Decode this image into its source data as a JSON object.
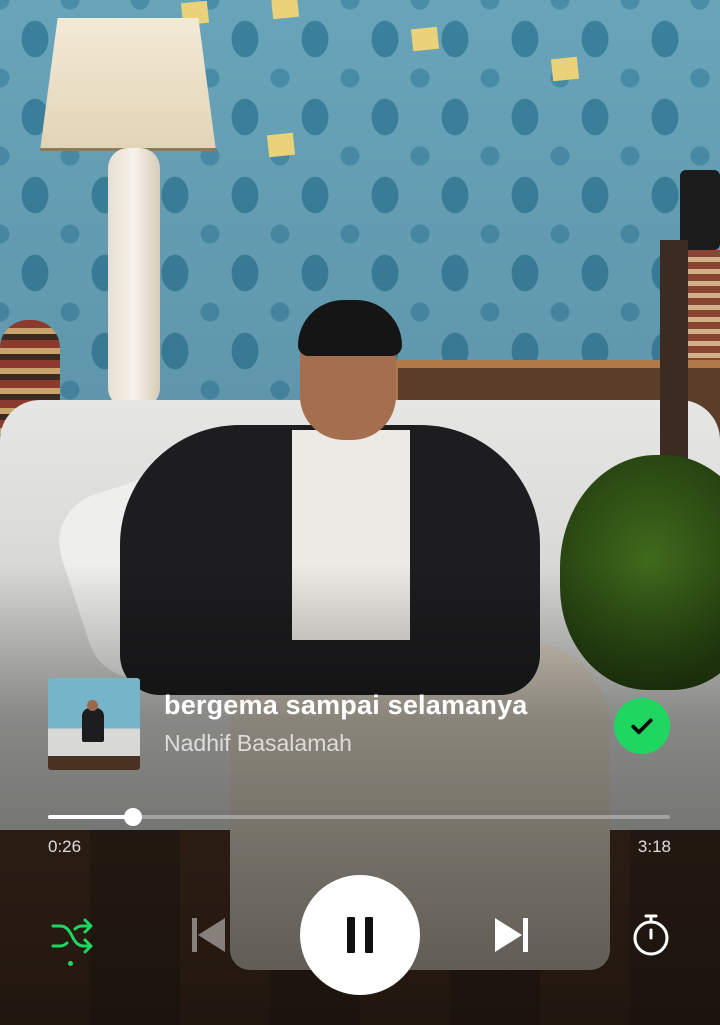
{
  "now_playing": {
    "title": "bergema sampai selamanya",
    "artist": "Nadhif Basalamah",
    "saved": true,
    "accent_color": "#1ed760"
  },
  "progress": {
    "current_time": "0:26",
    "total_time": "3:18",
    "fraction": 0.137
  },
  "controls": {
    "shuffle_icon": "shuffle-icon",
    "shuffle_active": true,
    "previous_icon": "skip-previous-icon",
    "play_state_icon": "pause-icon",
    "next_icon": "skip-next-icon",
    "sleep_timer_icon": "timer-icon"
  }
}
